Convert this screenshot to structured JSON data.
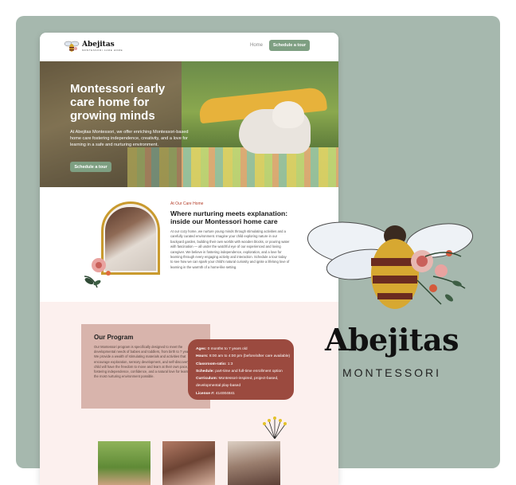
{
  "header": {
    "logo_name": "Abejitas",
    "logo_sub": "MONTESSORI CARE HOME",
    "nav_home": "Home",
    "cta": "Schedule a tour"
  },
  "hero": {
    "title": "Montessori early care home for growing minds",
    "description": "At Abejitas Montessori, we offer enriching Montessori-based home care fostering independence, creativity, and a love for learning in a safe and nurturing environment.",
    "cta": "Schedule a tour"
  },
  "about": {
    "kicker": "At Our Care Home",
    "title": "Where nurturing meets explanation: inside our Montessori home care",
    "body": "At our cozy home, we nurture young minds through stimulating activities and a carefully curated environment. Imagine your child exploring nature in our backyard garden, building their own worlds with wooden blocks, or pouring water with fascination — all under the watchful eye of our experienced and loving caregiver. We believe in fostering independence, exploration, and a love for learning through every engaging activity and interaction. Schedule a tour today to see how we can spark your child's natural curiosity and ignite a lifelong love of learning in the warmth of a home-like setting."
  },
  "program": {
    "title": "Our Program",
    "body": "Our Montessori program is specifically designed to meet the developmental needs of babies and toddlers, from birth to 7 years old. We provide a wealth of stimulating materials and activities that encourage exploration, sensory development, and self-discovery. Your child will have the freedom to move and learn at their own pace, fostering independence, confidence, and a natural love for learning in the most nurturing environment possible.",
    "info": [
      {
        "label": "Ages:",
        "value": "0 months to 7 years old"
      },
      {
        "label": "Hours:",
        "value": "8:00 am to 4:00 pm (before/after care available)"
      },
      {
        "label": "Classroom-ratio:",
        "value": "1:3"
      },
      {
        "label": "Schedule:",
        "value": "part-time and full-time enrollment option"
      },
      {
        "label": "Curriculum:",
        "value": "Montessori-inspired, project-based,"
      },
      {
        "label": "",
        "value": "developmental play-based"
      },
      {
        "label": "License #:",
        "value": "414004841"
      }
    ]
  },
  "brand": {
    "name": "Abejitas",
    "sub": "MONTESSORI"
  },
  "colors": {
    "background": "#a6b8ae",
    "accent_green": "#7e9f82",
    "info_card": "#9b4a3f",
    "program_bg": "#fcf0ee",
    "kicker_red": "#b43e2a"
  }
}
